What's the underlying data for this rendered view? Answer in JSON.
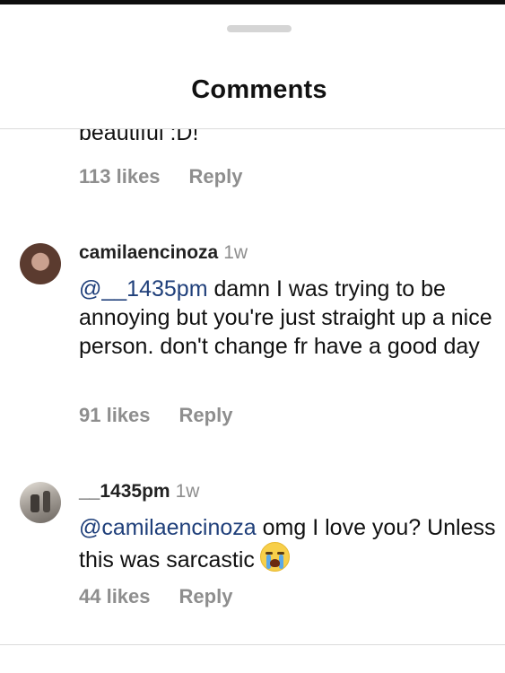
{
  "header": {
    "title": "Comments"
  },
  "comments": [
    {
      "text_tail": "beautiful :D!",
      "likes": "113 likes",
      "reply": "Reply"
    },
    {
      "username": "camilaencinoza",
      "time": "1w",
      "mention": "@__1435pm",
      "text": " damn I was trying to be annoying but you're just straight up a nice person. don't change fr have a good day",
      "likes": "91 likes",
      "reply": "Reply"
    },
    {
      "username": "__1435pm",
      "time": "1w",
      "mention": "@camilaencinoza",
      "text": " omg I love you? Unless this was sarcastic",
      "emoji": "loudly-crying-face-icon",
      "likes": "44 likes",
      "reply": "Reply"
    }
  ],
  "colors": {
    "mention": "#1f3f7a",
    "meta": "#8e8e8e",
    "divider": "#dbdbdb"
  }
}
